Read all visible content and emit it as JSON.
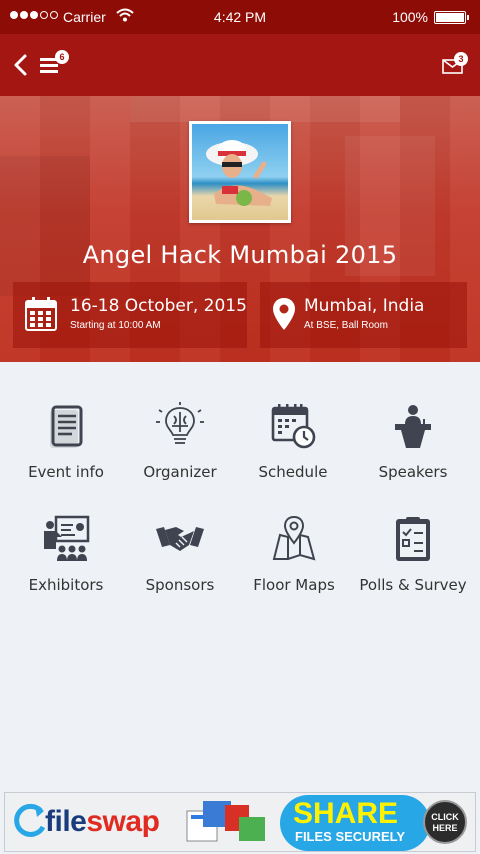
{
  "status_bar": {
    "carrier": "Carrier",
    "time": "4:42 PM",
    "battery": "100%"
  },
  "navbar": {
    "menu_badge": "6",
    "mail_badge": "3"
  },
  "event": {
    "title": "Angel Hack Mumbai 2015",
    "date": "16-18 October, 2015",
    "time_note": "Starting at 10:00 AM",
    "location": "Mumbai, India",
    "venue": "At BSE, Ball Room"
  },
  "menu": [
    {
      "label": "Event info",
      "icon": "document-icon"
    },
    {
      "label": "Organizer",
      "icon": "lightbulb-brain-icon"
    },
    {
      "label": "Schedule",
      "icon": "calendar-clock-icon"
    },
    {
      "label": "Speakers",
      "icon": "podium-speaker-icon"
    },
    {
      "label": "Exhibitors",
      "icon": "presentation-icon"
    },
    {
      "label": "Sponsors",
      "icon": "handshake-icon"
    },
    {
      "label": "Floor Maps",
      "icon": "map-pin-icon"
    },
    {
      "label": "Polls & Survey",
      "icon": "clipboard-checklist-icon"
    }
  ],
  "ad": {
    "brand_a": "file",
    "brand_b": "swap",
    "headline": "SHARE",
    "subline": "FILES SECURELY",
    "cta_a": "CLICK",
    "cta_b": "HERE"
  },
  "colors": {
    "header": "#a31611",
    "status": "#8e0c06",
    "hero": "#c33a2c",
    "background": "#eef1f5",
    "icon": "#3f4450"
  }
}
